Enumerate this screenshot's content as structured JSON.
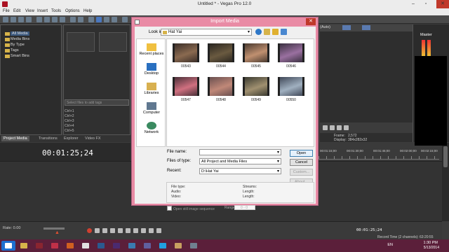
{
  "window": {
    "title": "Untitled * - Vegas Pro 12.0"
  },
  "menu": [
    "File",
    "Edit",
    "View",
    "Insert",
    "Tools",
    "Options",
    "Help"
  ],
  "explorer": {
    "tree": [
      "All Media",
      "Media Bins",
      "By Type",
      "Tags",
      "Smart Bins"
    ],
    "tags_placeholder": "Select files to add tags",
    "shortcuts": [
      "Ctrl+1",
      "Ctrl+2",
      "Ctrl+3",
      "Ctrl+4",
      "Ctrl+5"
    ]
  },
  "tabs": [
    "Project Media",
    "Transitions",
    "Explorer",
    "Video FX"
  ],
  "timeline": {
    "timecode": "00:01:25;24",
    "ruler": [
      "00:01:15;00",
      "00:01:30;00",
      "00:01:45;00",
      "00:02:00;00",
      "00:02:15;00"
    ],
    "rate": "Rate: 0.00",
    "transport_time": "00:01:25;24",
    "record_time": "Record Time (2 channels): 63:20:55"
  },
  "preview": {
    "quality": "(Auto)",
    "master_label": "Master",
    "frame_label": "Frame:",
    "frame_value": "2,572",
    "display_label": "Display:",
    "display_value": "384x282x32"
  },
  "dialog": {
    "title": "Import Media",
    "look_in_label": "Look in:",
    "look_in_value": "Hat Yai",
    "places": [
      "Recent places",
      "Desktop",
      "Libraries",
      "Computer",
      "Network"
    ],
    "files": [
      {
        "name": "00543",
        "color": "#3a2e28",
        "accent": "#8a6a50"
      },
      {
        "name": "00544",
        "color": "#2a2620",
        "accent": "#6a5a40"
      },
      {
        "name": "00545",
        "color": "#4a3a30",
        "accent": "#c09070"
      },
      {
        "name": "00546",
        "color": "#3a3040",
        "accent": "#9a70a0"
      },
      {
        "name": "00547",
        "color": "#4a3038",
        "accent": "#d07080"
      },
      {
        "name": "00548",
        "color": "#6a5050",
        "accent": "#c08878"
      },
      {
        "name": "00549",
        "color": "#3a3a30",
        "accent": "#a09070"
      },
      {
        "name": "00550",
        "color": "#404858",
        "accent": "#a0b0c0"
      }
    ],
    "file_name_label": "File name:",
    "file_name_value": "",
    "files_of_type_label": "Files of type:",
    "files_of_type_value": "All Project and Media Files",
    "recent_label": "Recent:",
    "recent_value": "D:\\Hat Yai",
    "buttons": {
      "open": "Open",
      "cancel": "Cancel",
      "custom": "Custom...",
      "about": "About..."
    },
    "props": {
      "file_type": "File type:",
      "audio": "Audio:",
      "video": "Video:",
      "streams": "Streams:",
      "length1": "Length:",
      "length2": "Length:"
    },
    "still_seq": "Open still image sequence",
    "range_label": "Range:",
    "range_value": "0 - 0"
  },
  "taskbar": {
    "lang": "EN",
    "time": "1:30 PM",
    "date": "5/13/2014",
    "apps": [
      {
        "icon": "folder-icon",
        "color": "#d6b34a"
      },
      {
        "icon": "vegas-icon",
        "color": "#8a2530"
      },
      {
        "icon": "media-icon",
        "color": "#c03048"
      },
      {
        "icon": "app-icon",
        "color": "#d06020"
      },
      {
        "icon": "chrome-icon",
        "color": "#e0e0e0"
      },
      {
        "icon": "photoshop-icon",
        "color": "#2a5a90"
      },
      {
        "icon": "premiere-icon",
        "color": "#4a2a70"
      },
      {
        "icon": "app2-icon",
        "color": "#3a7ab0"
      },
      {
        "icon": "video-icon",
        "color": "#6060a0"
      },
      {
        "icon": "skype-icon",
        "color": "#20a0e0"
      },
      {
        "icon": "paint-icon",
        "color": "#c8a060"
      },
      {
        "icon": "tool-icon",
        "color": "#708090"
      }
    ]
  }
}
